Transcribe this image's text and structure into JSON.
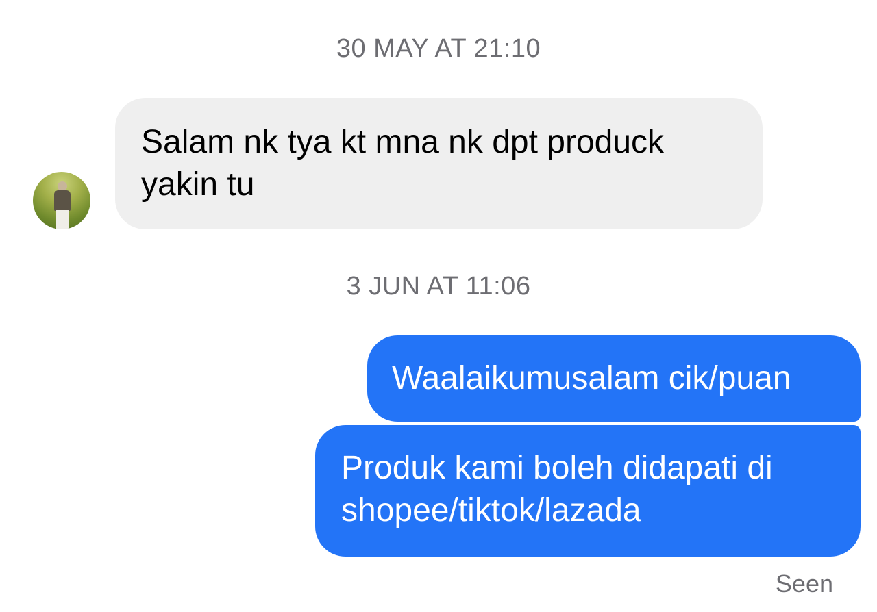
{
  "conversation": {
    "timestamp_1": "30 MAY AT 21:10",
    "incoming_message": "Salam nk tya kt mna nk dpt produck yakin tu",
    "timestamp_2": "3 JUN AT 11:06",
    "outgoing_messages": [
      "Waalaikumusalam cik/puan",
      "Produk kami boleh didapati di shopee/tiktok/lazada"
    ],
    "status": "Seen"
  },
  "colors": {
    "outgoing_bubble": "#2374f7",
    "incoming_bubble": "#efefef",
    "timestamp_text": "#6d6d72"
  }
}
